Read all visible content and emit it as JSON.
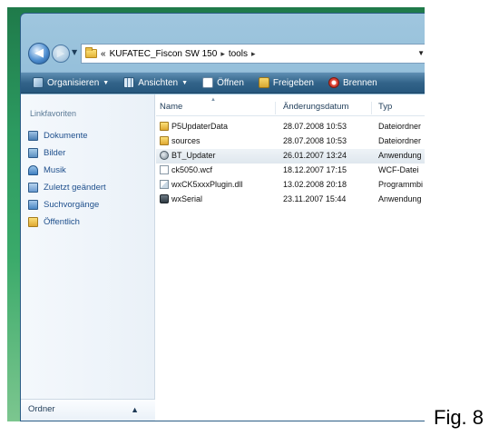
{
  "address_bar": {
    "prefix": "«",
    "segments": [
      "KUFATEC_Fiscon SW 150",
      "tools"
    ],
    "separator": "▸"
  },
  "toolbar": {
    "items": [
      {
        "label": "Organisieren",
        "icon": "organize-icon"
      },
      {
        "label": "Ansichten",
        "icon": "views-icon"
      },
      {
        "label": "Öffnen",
        "icon": "open-icon"
      },
      {
        "label": "Freigeben",
        "icon": "share-icon"
      },
      {
        "label": "Brennen",
        "icon": "burn-icon"
      }
    ]
  },
  "nav_pane": {
    "heading": "Linkfavoriten",
    "items": [
      {
        "label": "Dokumente",
        "icon": "documents-icon"
      },
      {
        "label": "Bilder",
        "icon": "pictures-icon"
      },
      {
        "label": "Musik",
        "icon": "music-icon"
      },
      {
        "label": "Zuletzt geändert",
        "icon": "recent-icon"
      },
      {
        "label": "Suchvorgänge",
        "icon": "searches-icon"
      },
      {
        "label": "Öffentlich",
        "icon": "public-folder-icon"
      }
    ],
    "folders_label": "Ordner"
  },
  "file_list": {
    "columns": [
      "Name",
      "Änderungsdatum",
      "Typ"
    ],
    "rows": [
      {
        "name": "P5UpdaterData",
        "date": "28.07.2008 10:53",
        "type": "Dateiordner",
        "icon": "folder-icon"
      },
      {
        "name": "sources",
        "date": "28.07.2008 10:53",
        "type": "Dateiordner",
        "icon": "folder-icon"
      },
      {
        "name": "BT_Updater",
        "date": "26.01.2007 13:24",
        "type": "Anwendung",
        "icon": "application-icon",
        "selected": true
      },
      {
        "name": "ck5050.wcf",
        "date": "18.12.2007 17:15",
        "type": "WCF-Datei",
        "icon": "file-icon"
      },
      {
        "name": "wxCK5xxxPlugin.dll",
        "date": "13.02.2008 20:18",
        "type": "Programmbi",
        "icon": "dll-icon"
      },
      {
        "name": "wxSerial",
        "date": "23.11.2007 15:44",
        "type": "Anwendung",
        "icon": "serial-app-icon"
      }
    ]
  },
  "caption": "Fig. 8"
}
